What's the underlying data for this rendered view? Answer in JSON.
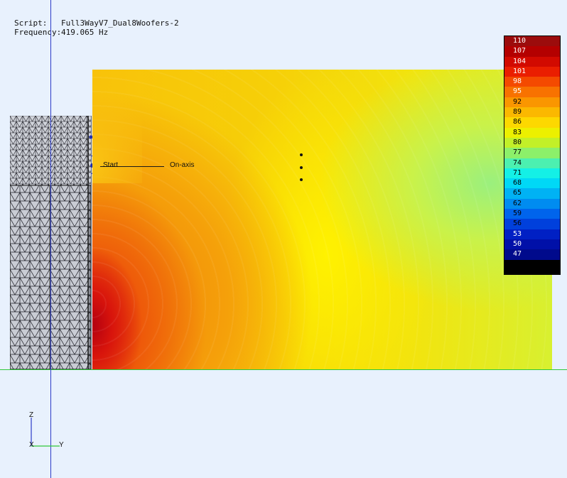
{
  "info": {
    "script_key": "Script:",
    "script_value": "Full3WayV7_Dual8Woofers-2",
    "frequency_key": "Frequency:",
    "frequency_value": "419.065 Hz"
  },
  "field_labels": {
    "start": "Start",
    "on_axis": "On-axis"
  },
  "axes": {
    "z": "Z",
    "x": "X",
    "y": "Y"
  },
  "legend": {
    "items": [
      {
        "label": "110",
        "color": "#9c0c0c"
      },
      {
        "label": "107",
        "color": "#b40000"
      },
      {
        "label": "104",
        "color": "#d20a00"
      },
      {
        "label": "101",
        "color": "#ea1e00"
      },
      {
        "label": "98",
        "color": "#f44a00"
      },
      {
        "label": "95",
        "color": "#f87200"
      },
      {
        "label": "92",
        "color": "#fa9600"
      },
      {
        "label": "89",
        "color": "#fbb800"
      },
      {
        "label": "86",
        "color": "#fdd800"
      },
      {
        "label": "83",
        "color": "#ecf000"
      },
      {
        "label": "80",
        "color": "#c2f028"
      },
      {
        "label": "77",
        "color": "#8cf06a"
      },
      {
        "label": "74",
        "color": "#4cf0b0"
      },
      {
        "label": "71",
        "color": "#14f0e6"
      },
      {
        "label": "68",
        "color": "#00d8f6"
      },
      {
        "label": "65",
        "color": "#00b2f4"
      },
      {
        "label": "62",
        "color": "#008cf0"
      },
      {
        "label": "59",
        "color": "#0064ec"
      },
      {
        "label": "56",
        "color": "#0040dc"
      },
      {
        "label": "53",
        "color": "#0020c4"
      },
      {
        "label": "50",
        "color": "#0010a8"
      },
      {
        "label": "47",
        "color": "#000a8c"
      },
      {
        "label": "",
        "color": "#000000"
      }
    ]
  }
}
